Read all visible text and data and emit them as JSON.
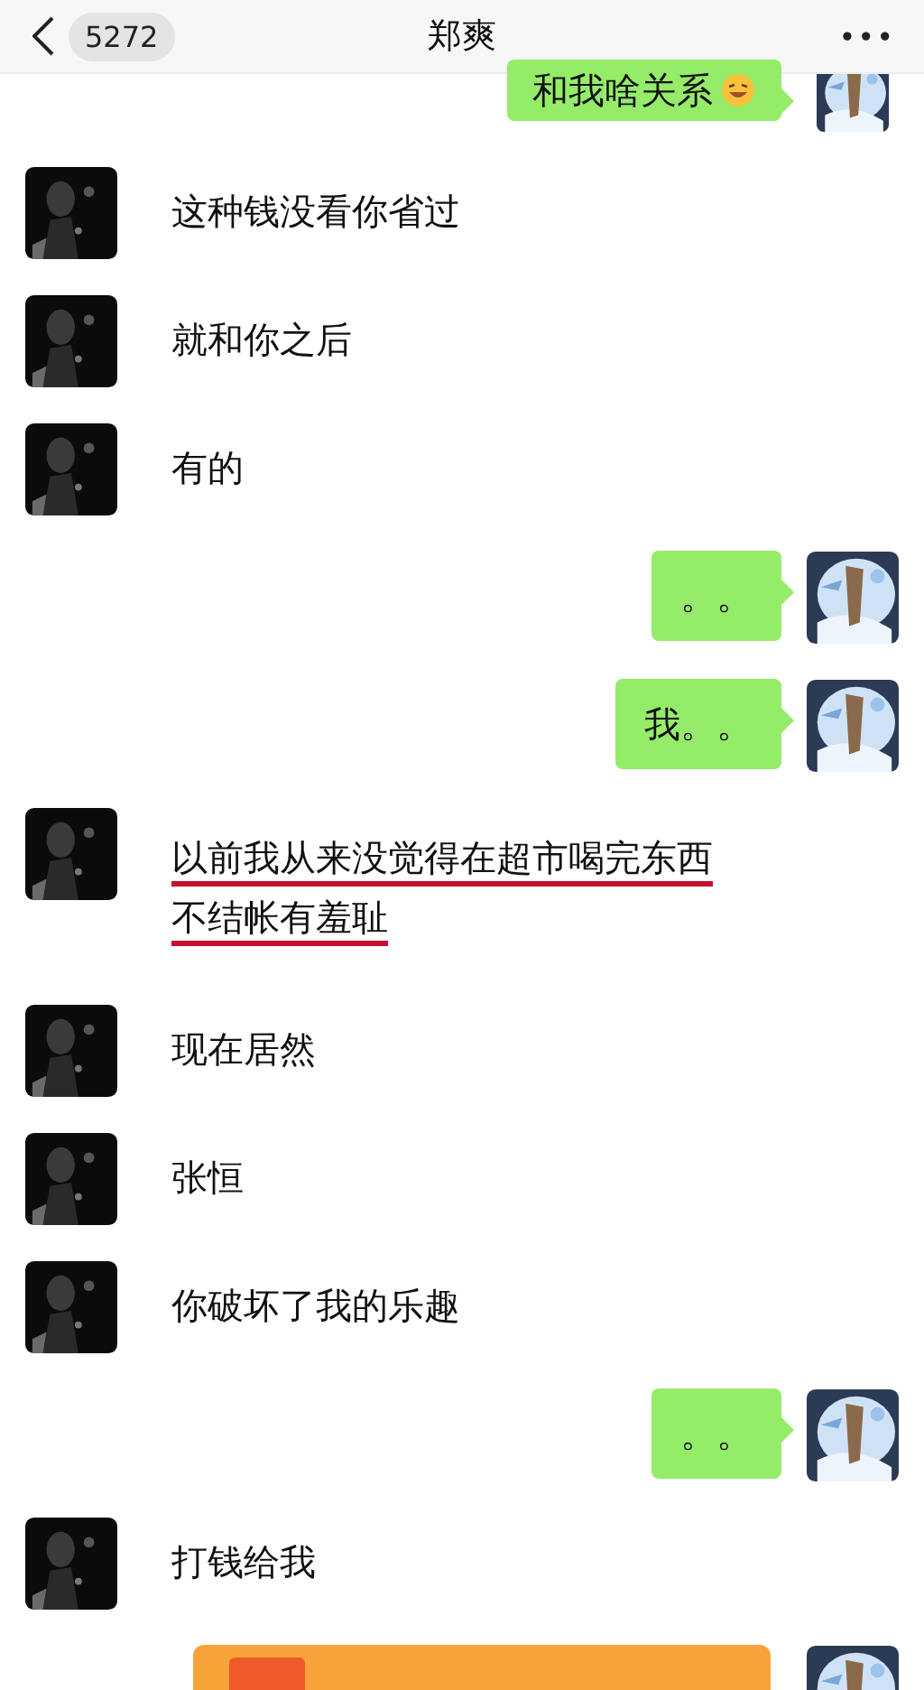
{
  "header": {
    "back_count": "5272",
    "title": "郑爽",
    "more": "•••"
  },
  "messages": [
    {
      "sent": true,
      "kind": "text",
      "text": "和我啥关系",
      "emoji": true,
      "underlined": false
    },
    {
      "sent": false,
      "kind": "text",
      "text": "这种钱没看你省过",
      "underlined": false
    },
    {
      "sent": false,
      "kind": "text",
      "text": "就和你之后",
      "underlined": false
    },
    {
      "sent": false,
      "kind": "text",
      "text": "有的",
      "underlined": false
    },
    {
      "sent": true,
      "kind": "text",
      "text": "。。",
      "underlined": false
    },
    {
      "sent": true,
      "kind": "text",
      "text": "我。。",
      "underlined": false
    },
    {
      "sent": false,
      "kind": "text",
      "text": "以前我从来没觉得在超市喝完东西不结帐有羞耻",
      "underlined": true
    },
    {
      "sent": false,
      "kind": "text",
      "text": "现在居然",
      "underlined": false
    },
    {
      "sent": false,
      "kind": "text",
      "text": "张恒",
      "underlined": false
    },
    {
      "sent": false,
      "kind": "text",
      "text": "你破坏了我的乐趣",
      "underlined": false
    },
    {
      "sent": true,
      "kind": "text",
      "text": "。。",
      "underlined": false
    },
    {
      "sent": false,
      "kind": "text",
      "text": "打钱给我",
      "underlined": false
    },
    {
      "sent": true,
      "kind": "transfer"
    }
  ]
}
